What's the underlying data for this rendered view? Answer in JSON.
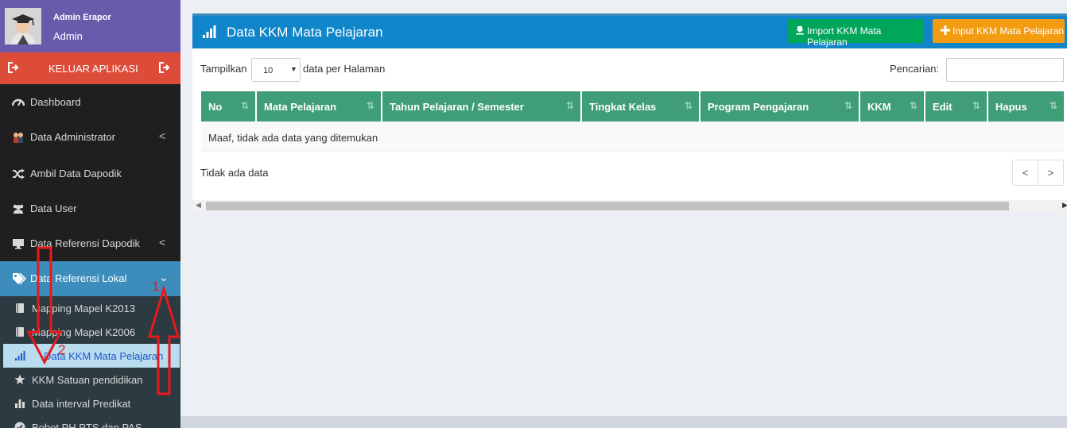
{
  "user": {
    "name": "Admin Erapor",
    "role": "Admin"
  },
  "logout": {
    "label": "KELUAR APLIKASI"
  },
  "sidebar": {
    "items": [
      {
        "label": "Dashboard",
        "icon": "dashboard-icon"
      },
      {
        "label": "Data Administrator",
        "icon": "users-icon"
      },
      {
        "label": "Ambil Data Dapodik",
        "icon": "shuffle-icon"
      },
      {
        "label": "Data User",
        "icon": "group-icon"
      },
      {
        "label": "Data Referensi Dapodik",
        "icon": "desktop-icon"
      },
      {
        "label": "Data Referensi Lokal",
        "icon": "tags-icon"
      }
    ],
    "submenu": [
      {
        "label": "Mapping Mapel K2013",
        "icon": "book-icon"
      },
      {
        "label": "Mapping Mapel K2006",
        "icon": "book-icon"
      },
      {
        "label": "Data KKM Mata Pelajaran",
        "icon": "signal-icon"
      },
      {
        "label": "KKM Satuan pendidikan",
        "icon": "star-icon"
      },
      {
        "label": "Data interval Predikat",
        "icon": "bar-chart-icon"
      },
      {
        "label": "Bobot PH,PTS dan PAS",
        "icon": "check-circle-icon"
      }
    ],
    "chevron_left": "<",
    "chevron_down": "⌄"
  },
  "box": {
    "title": "Data KKM Mata Pelajaran",
    "import_label": "Import KKM Mata Pelajaran",
    "input_label": "Input KKM Mata Pelajaran"
  },
  "table": {
    "show_label": "Tampilkan",
    "per_page_value": "10",
    "per_page_label": "data per Halaman",
    "search_label": "Pencarian:",
    "columns": [
      "No",
      "Mata Pelajaran",
      "Tahun Pelajaran / Semester",
      "Tingkat Kelas",
      "Program Pengajaran",
      "KKM",
      "Edit",
      "Hapus"
    ],
    "empty_message": "Maaf, tidak ada data yang ditemukan",
    "info": "Tidak ada data",
    "prev": "<",
    "next": ">"
  },
  "annotations": {
    "label_1": "1",
    "label_2": "2"
  },
  "colors": {
    "sidebar_bg": "#1f1f1f",
    "user_panel": "#6a5aac",
    "logout": "#dd4b39",
    "active_menu": "#3c8dbc",
    "header": "#1085c9",
    "import_btn": "#00a65a",
    "input_btn": "#f39c12",
    "table_header": "#3f9e77",
    "annotation": "#e8191c"
  }
}
